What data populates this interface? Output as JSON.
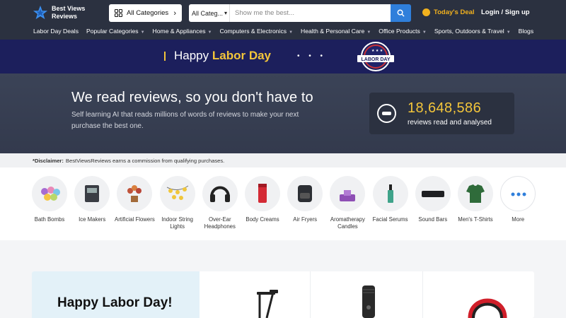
{
  "header": {
    "logo_line1": "Best Views",
    "logo_line2": "Reviews",
    "all_categories": "All Categories",
    "search_category": "All Categories",
    "search_category_short": "All Categ...",
    "search_placeholder": "Show me the best...",
    "todays_deal": "Today's Deal",
    "login": "Login / Sign up"
  },
  "nav": {
    "items": [
      {
        "label": "Labor Day Deals",
        "dropdown": false
      },
      {
        "label": "Popular Categories",
        "dropdown": true
      },
      {
        "label": "Home & Appliances",
        "dropdown": true
      },
      {
        "label": "Computers & Electronics",
        "dropdown": true
      },
      {
        "label": "Health & Personal Care",
        "dropdown": true
      },
      {
        "label": "Office Products",
        "dropdown": true
      },
      {
        "label": "Sports, Outdoors & Travel",
        "dropdown": true
      },
      {
        "label": "Blogs",
        "dropdown": false
      }
    ]
  },
  "banner": {
    "prefix": "Happy",
    "highlight": "Labor Day",
    "badge_text": "LABOR DAY"
  },
  "hero": {
    "title": "We read reviews, so you don't have to",
    "subtitle": "Self learning AI that reads millions of words of reviews to make your next purchase the best one.",
    "stat_number": "18,648,586",
    "stat_label": "reviews read and analysed"
  },
  "disclaimer": {
    "label": "*Disclaimer:",
    "text": "BestViewsReviews earns a commission from qualifying purchases."
  },
  "categories": [
    {
      "label": "Bath Bombs",
      "icon": "bath-bombs-icon"
    },
    {
      "label": "Ice Makers",
      "icon": "ice-maker-icon"
    },
    {
      "label": "Artificial Flowers",
      "icon": "artificial-flowers-icon"
    },
    {
      "label": "Indoor String Lights",
      "icon": "string-lights-icon"
    },
    {
      "label": "Over-Ear Headphones",
      "icon": "headphones-icon"
    },
    {
      "label": "Body Creams",
      "icon": "body-cream-icon"
    },
    {
      "label": "Air Fryers",
      "icon": "air-fryer-icon"
    },
    {
      "label": "Aromatherapy Candles",
      "icon": "candle-icon"
    },
    {
      "label": "Facial Serums",
      "icon": "serum-icon"
    },
    {
      "label": "Sound Bars",
      "icon": "soundbar-icon"
    },
    {
      "label": "Men's T-Shirts",
      "icon": "tshirt-icon"
    },
    {
      "label": "More",
      "icon": "more-dots-icon"
    }
  ],
  "promo": {
    "title": "Happy Labor Day!"
  },
  "colors": {
    "header_bg": "#2b3140",
    "banner_bg": "#1c1f5c",
    "accent_yellow": "#f3c53a",
    "search_button": "#2f7fdb",
    "hero_bg": "#363d50"
  }
}
